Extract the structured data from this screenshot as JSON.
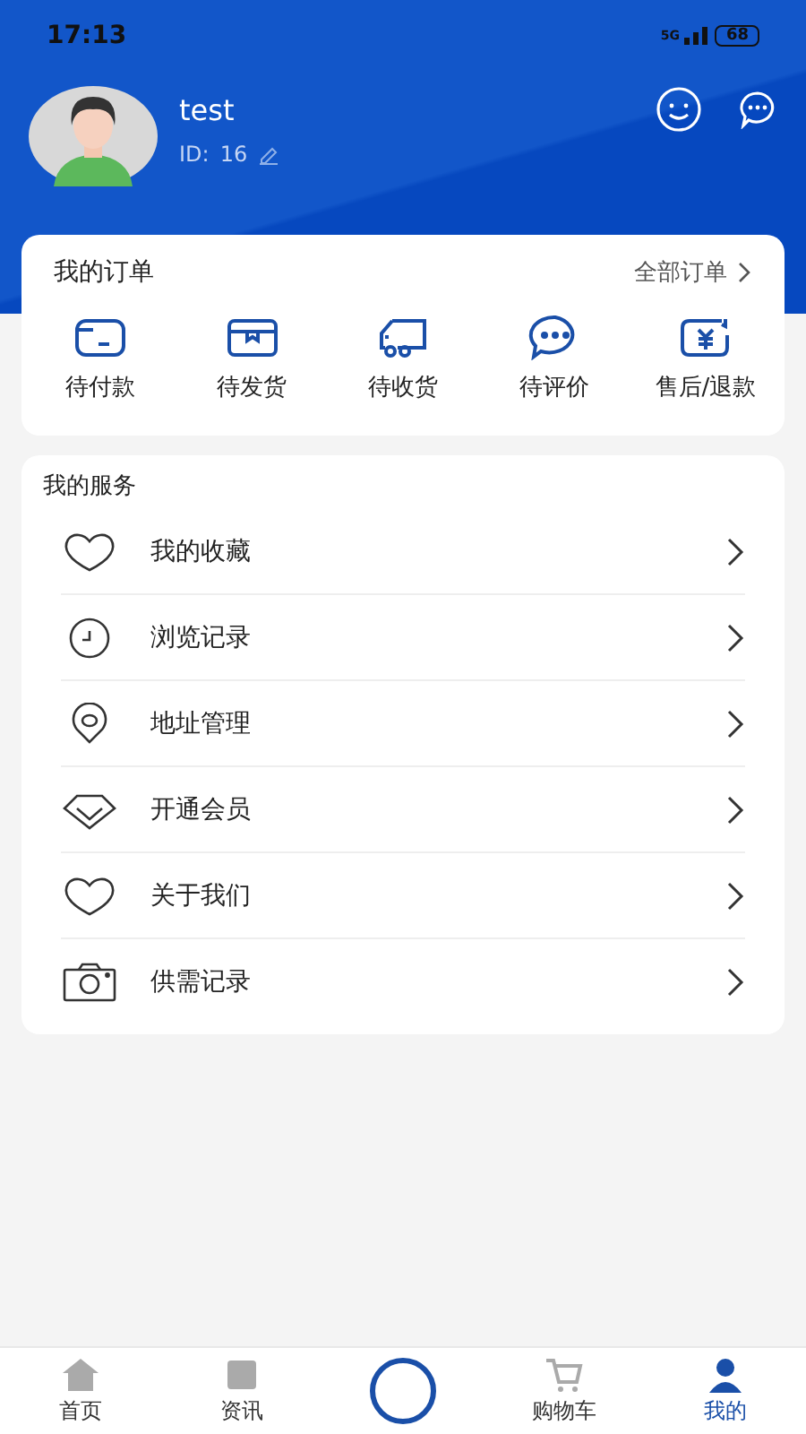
{
  "status_bar": {
    "time": "17:13",
    "network": "5G",
    "battery": "68"
  },
  "profile": {
    "name": "test",
    "id_label": "ID:",
    "id": "16"
  },
  "orders": {
    "title": "我的订单",
    "all_link": "全部订单",
    "items": [
      {
        "label": "待付款"
      },
      {
        "label": "待发货"
      },
      {
        "label": "待收货"
      },
      {
        "label": "待评价"
      },
      {
        "label": "售后/退款"
      }
    ]
  },
  "services": {
    "title": "我的服务",
    "items": [
      {
        "label": "我的收藏"
      },
      {
        "label": "浏览记录"
      },
      {
        "label": "地址管理"
      },
      {
        "label": "开通会员"
      },
      {
        "label": "关于我们"
      },
      {
        "label": "供需记录"
      }
    ]
  },
  "tab_bar": [
    {
      "kind": "home",
      "label": "首页",
      "selected": false
    },
    {
      "kind": "news",
      "label": "资讯",
      "selected": false
    },
    {
      "kind": "center",
      "selected": false
    },
    {
      "kind": "cart",
      "label": "购物车",
      "selected": false
    },
    {
      "kind": "me",
      "label": "我的",
      "selected": true
    }
  ]
}
